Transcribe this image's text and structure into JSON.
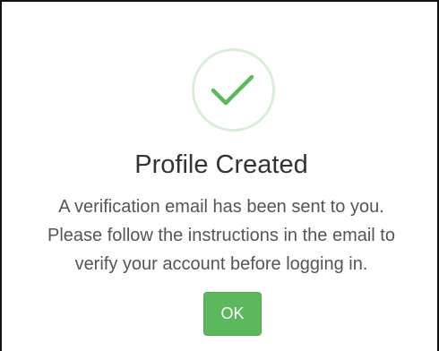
{
  "dialog": {
    "icon": "check-circle-icon",
    "title": "Profile Created",
    "message_lines": [
      "A verification email has been sent to you.",
      "Please follow the instructions in the email to",
      "verify your account before logging in."
    ],
    "ok_label": "OK"
  },
  "colors": {
    "success_green": "#5cb85c",
    "icon_ring": "#d8eed8",
    "checkmark": "#5cb85c"
  }
}
